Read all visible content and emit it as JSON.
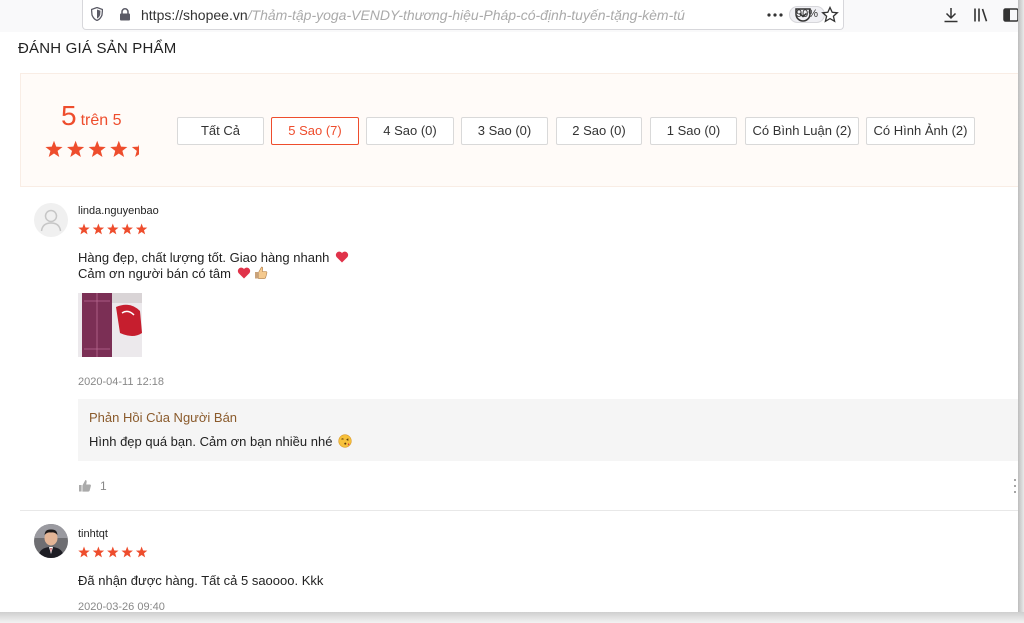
{
  "browser": {
    "url_host": "https://shopee.vn",
    "url_path": "/Thảm-tập-yoga-VENDY-thương-hiệu-Pháp-có-định-tuyến-tặng-kèm-tú",
    "zoom": "90%",
    "icons": [
      "shield-icon",
      "lock-icon",
      "more-icon",
      "pocket-icon",
      "bookmark-star-icon",
      "download-icon",
      "library-icon",
      "sidebar-icon"
    ]
  },
  "page": {
    "title": "ĐÁNH GIÁ SẢN PHẨM"
  },
  "overview": {
    "score": "5",
    "score_suffix": "trên 5",
    "rating_value": 5,
    "star_color": "#ee4d2d",
    "filters": [
      {
        "label": "Tất Cả",
        "active": false
      },
      {
        "label": "5 Sao (7)",
        "active": true
      },
      {
        "label": "4 Sao (0)",
        "active": false
      },
      {
        "label": "3 Sao (0)",
        "active": false
      },
      {
        "label": "2 Sao (0)",
        "active": false
      },
      {
        "label": "1 Sao (0)",
        "active": false
      },
      {
        "label": "Có Bình Luận (2)",
        "active": false
      },
      {
        "label": "Có Hình Ảnh (2)",
        "active": false
      }
    ]
  },
  "reviews": [
    {
      "username": "linda.nguyenbao",
      "rating": 5,
      "lines": [
        "Hàng đẹp, chất lượng tốt. Giao hàng nhanh",
        "Cảm ơn người bán có tâm"
      ],
      "date": "2020-04-11 12:18",
      "reply": {
        "title": "Phản Hồi Của Người Bán",
        "text": "Hình đẹp quá bạn. Cảm ơn bạn nhiều nhé"
      },
      "likes": "1"
    },
    {
      "username": "tinhtqt",
      "rating": 5,
      "lines": [
        "Đã nhận được hàng. Tất cả 5 saoooo. Kkk"
      ],
      "date": "2020-03-26 09:40"
    }
  ]
}
